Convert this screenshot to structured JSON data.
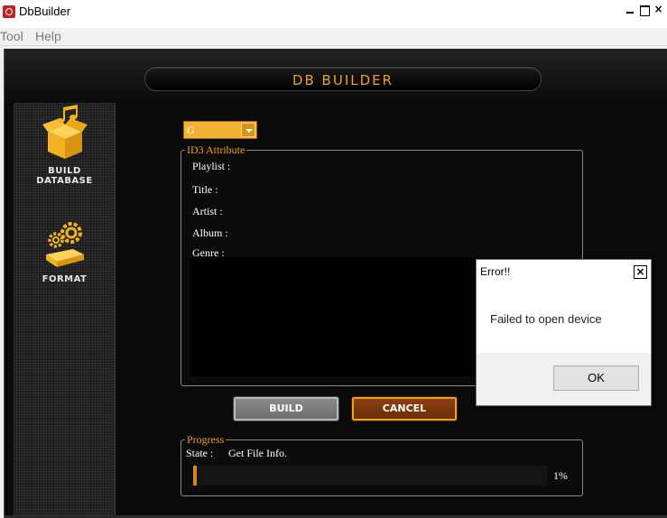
{
  "window": {
    "title": "DbBuilder",
    "controls": {
      "minimize": "_",
      "maximize": "□",
      "close": "×"
    }
  },
  "menu": {
    "items": [
      "Tool",
      "Help"
    ]
  },
  "app": {
    "header_title": "DB BUILDER",
    "sidebar": [
      {
        "label_line1": "BUILD",
        "label_line2": "DATABASE",
        "icon": "music-box-icon"
      },
      {
        "label_line1": "FORMAT",
        "label_line2": "",
        "icon": "gears-usb-icon"
      }
    ],
    "drive": {
      "selected": "G"
    },
    "id3": {
      "legend": "ID3 Attribute",
      "rows": [
        {
          "label": "Playlist :"
        },
        {
          "label": "Title :"
        },
        {
          "label": "Artist :"
        },
        {
          "label": "Album :"
        },
        {
          "label": "Genre :"
        }
      ]
    },
    "buttons": {
      "build": "BUILD",
      "cancel": "CANCEL"
    },
    "progress": {
      "legend": "Progress",
      "state_label": "State :",
      "state_value": "Get File Info.",
      "percent_text": "1%",
      "percent": 1
    }
  },
  "dialog": {
    "title": "Error!!",
    "close": "×",
    "message": "Failed to open device",
    "ok": "OK"
  },
  "colors": {
    "accent": "#f0a020",
    "cancel_bg": "#6a2e08",
    "build_bg": "#7a7a7a",
    "app_bg": "#0b0b0b"
  }
}
